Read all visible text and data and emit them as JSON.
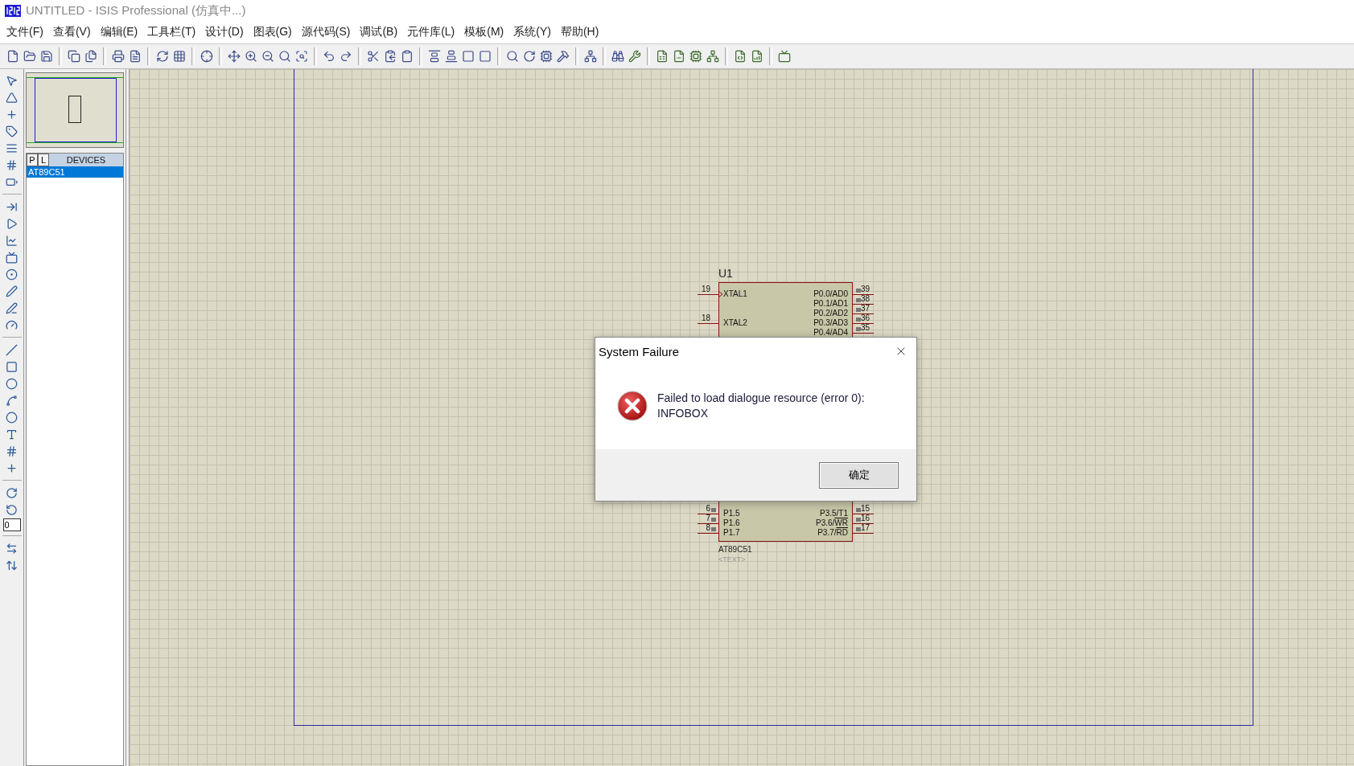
{
  "window": {
    "title": "UNTITLED - ISIS Professional (仿真中...)"
  },
  "menu": [
    "文件(F)",
    "查看(V)",
    "编辑(E)",
    "工具栏(T)",
    "设计(D)",
    "图表(G)",
    "源代码(S)",
    "调试(B)",
    "元件库(L)",
    "模板(M)",
    "系统(Y)",
    "帮助(H)"
  ],
  "rotation_field": {
    "value": "0"
  },
  "device_selector": {
    "buttons": [
      "P",
      "L"
    ],
    "heading": "DEVICES",
    "items": [
      {
        "label": "AT89C51",
        "selected": true
      }
    ]
  },
  "component": {
    "reference": "U1",
    "part": "AT89C51",
    "text": "<TEXT>",
    "left_top_pins": [
      {
        "number": "19",
        "name": "XTAL1",
        "clock": true
      },
      {
        "number": "18",
        "name": "XTAL2",
        "clock": false
      }
    ],
    "left_bottom_pins": [
      {
        "number": "6",
        "name": "P1.5",
        "clock": false
      },
      {
        "number": "7",
        "name": "P1.6",
        "clock": false
      },
      {
        "number": "8",
        "name": "P1.7",
        "clock": false
      }
    ],
    "right_top_pins": [
      {
        "number": "39",
        "name": "P0.0/AD0"
      },
      {
        "number": "38",
        "name": "P0.1/AD1"
      },
      {
        "number": "37",
        "name": "P0.2/AD2"
      },
      {
        "number": "36",
        "name": "P0.3/AD3"
      },
      {
        "number": "35",
        "name": "P0.4/AD4"
      }
    ],
    "right_bottom_pins": [
      {
        "number": "15",
        "name": "P3.5/T1"
      },
      {
        "number": "16",
        "name": "P3.6/",
        "inverted": "WR"
      },
      {
        "number": "17",
        "name": "P3.7/",
        "inverted": "RD"
      }
    ]
  },
  "dialog": {
    "title": "System Failure",
    "message": "Failed to load dialogue resource (error 0):",
    "detail": "INFOBOX",
    "button": "确定"
  }
}
